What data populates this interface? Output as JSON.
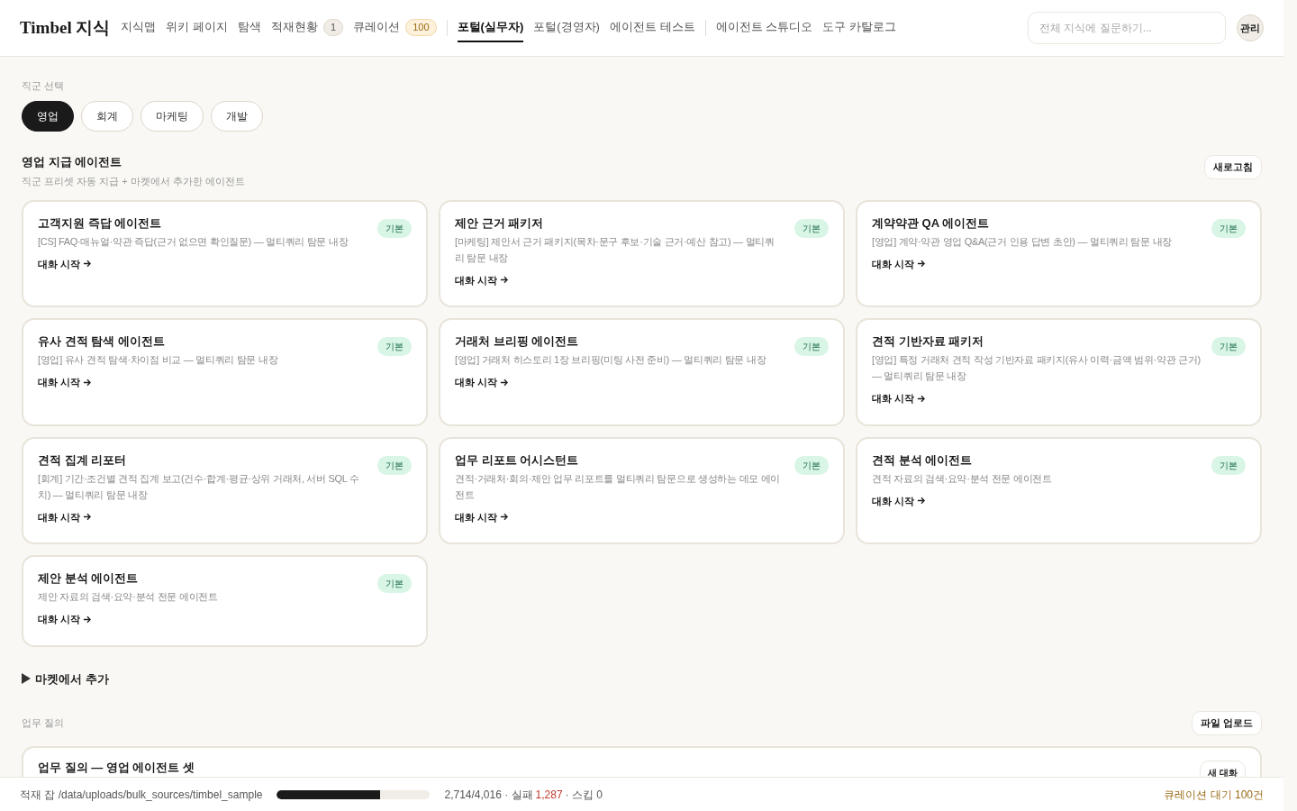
{
  "header": {
    "logo": "Timbel 지식",
    "nav": [
      {
        "label": "지식맵",
        "selected": false
      },
      {
        "label": "위키 페이지",
        "selected": false
      },
      {
        "label": "탐색",
        "selected": false
      },
      {
        "label": "적재현황",
        "selected": false,
        "badge": {
          "text": "1",
          "kind": "neutral"
        }
      },
      {
        "label": "큐레이션",
        "selected": false,
        "badge": {
          "text": "100",
          "kind": "warning"
        },
        "divider_after": true
      },
      {
        "label": "포털(실무자)",
        "selected": true
      },
      {
        "label": "포털(경영자)",
        "selected": false
      },
      {
        "label": "에이전트 테스트",
        "selected": false,
        "divider_after": true
      },
      {
        "label": "에이전트 스튜디오",
        "selected": false
      },
      {
        "label": "도구 카탈로그",
        "selected": false
      }
    ],
    "search": {
      "placeholder": "전체 지식에 질문하기..."
    },
    "admin_button": "관리"
  },
  "role_select": {
    "label": "직군 선택",
    "roles": [
      {
        "label": "영업",
        "selected": true
      },
      {
        "label": "회계",
        "selected": false
      },
      {
        "label": "마케팅",
        "selected": false
      },
      {
        "label": "개발",
        "selected": false
      }
    ]
  },
  "agents_section": {
    "title": "영업 지급 에이전트",
    "subtitle": "직군 프리셋 자동 지급 + 마켓에서 추가한 에이전트",
    "refresh_button": "새로고침",
    "cards": [
      {
        "title": "고객지원 즉답 에이전트",
        "tag": "기본",
        "description": "[CS] FAQ·매뉴얼·약관 즉답(근거 없으면 확인질문) — 멀티쿼리 탐문 내장",
        "action": "대화 시작"
      },
      {
        "title": "제안 근거 패키저",
        "tag": "기본",
        "description": "[마케팅] 제안서 근거 패키지(목차·문구 후보·기술 근거·예산 참고) — 멀티쿼리 탐문 내장",
        "action": "대화 시작"
      },
      {
        "title": "계약약관 QA 에이전트",
        "tag": "기본",
        "description": "[영업] 계약·약관 영업 Q&A(근거 인용 답변 초안) — 멀티쿼리 탐문 내장",
        "action": "대화 시작"
      },
      {
        "title": "유사 견적 탐색 에이전트",
        "tag": "기본",
        "description": "[영업] 유사 견적 탐색·차이점 비교 — 멀티쿼리 탐문 내장",
        "action": "대화 시작"
      },
      {
        "title": "거래처 브리핑 에이전트",
        "tag": "기본",
        "description": "[영업] 거래처 히스토리 1장 브리핑(미팅 사전 준비) — 멀티쿼리 탐문 내장",
        "action": "대화 시작"
      },
      {
        "title": "견적 기반자료 패키저",
        "tag": "기본",
        "description": "[영업] 특정 거래처 견적 작성 기반자료 패키지(유사 이력·금액 범위·약관 근거) — 멀티쿼리 탐문 내장",
        "action": "대화 시작"
      },
      {
        "title": "견적 집계 리포터",
        "tag": "기본",
        "description": "[회계] 기간·조건별 견적 집계 보고(건수·합계·평균·상위 거래처, 서버 SQL 수치) — 멀티쿼리 탐문 내장",
        "action": "대화 시작"
      },
      {
        "title": "업무 리포트 어시스턴트",
        "tag": "기본",
        "description": "견적·거래처·회의·제안 업무 리포트를 멀티쿼리 탐문으로 생성하는 데모 에이전트",
        "action": "대화 시작"
      },
      {
        "title": "견적 분석 에이전트",
        "tag": "기본",
        "description": "견적 자료의 검색·요약·분석 전문 에이전트",
        "action": "대화 시작"
      },
      {
        "title": "제안 분석 에이전트",
        "tag": "기본",
        "description": "제안 자료의 검색·요약·분석 전문 에이전트",
        "action": "대화 시작"
      }
    ]
  },
  "market": {
    "label": "마켓에서 추가",
    "expanded": false
  },
  "work_query": {
    "label": "업무 질의",
    "upload_button": "파일 업로드",
    "card_title": "업무 질의 — 영업 에이전트 셋",
    "new_chat_button": "새 대화"
  },
  "status_bar": {
    "job": "적재 잡 /data/uploads/bulk_sources/timbel_sample",
    "level": 0.676,
    "progress": "2,714/4,016 · 실패",
    "failed": "1,287",
    "skipped": "· 스킵 0",
    "curation": "큐레이션 대기 100건"
  }
}
